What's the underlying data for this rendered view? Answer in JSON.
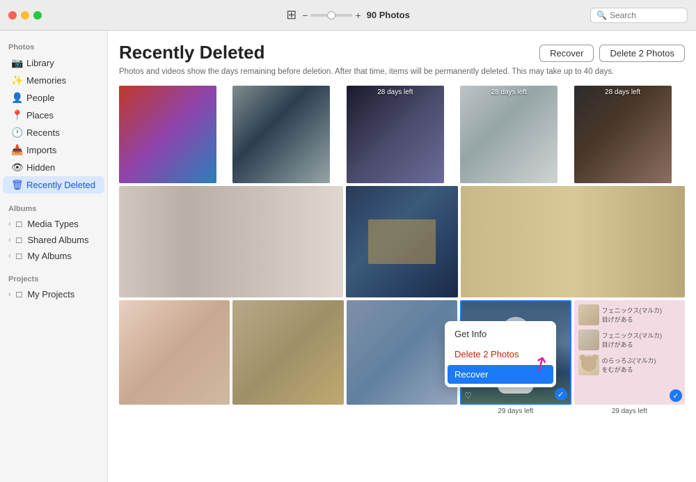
{
  "titleBar": {
    "title": "90 Photos",
    "search": {
      "placeholder": "Search"
    },
    "zoom": {
      "minus": "−",
      "plus": "+"
    }
  },
  "sidebar": {
    "photosLabel": "Photos",
    "albumsLabel": "Albums",
    "projectsLabel": "Projects",
    "items": [
      {
        "id": "library",
        "label": "Library",
        "icon": "📷"
      },
      {
        "id": "memories",
        "label": "Memories",
        "icon": "✨"
      },
      {
        "id": "people",
        "label": "People",
        "icon": "👤"
      },
      {
        "id": "places",
        "label": "Places",
        "icon": "📍"
      },
      {
        "id": "recents",
        "label": "Recents",
        "icon": "🕐"
      },
      {
        "id": "imports",
        "label": "Imports",
        "icon": "📥"
      },
      {
        "id": "hidden",
        "label": "Hidden",
        "icon": "👁"
      },
      {
        "id": "recently-deleted",
        "label": "Recently Deleted",
        "icon": "🗑",
        "active": true
      }
    ],
    "albumGroups": [
      {
        "id": "media-types",
        "label": "Media Types"
      },
      {
        "id": "shared-albums",
        "label": "Shared Albums"
      },
      {
        "id": "my-albums",
        "label": "My Albums"
      }
    ],
    "projectGroups": [
      {
        "id": "my-projects",
        "label": "My Projects"
      }
    ]
  },
  "content": {
    "pageTitle": "Recently Deleted",
    "subtitle": "Photos and videos show the days remaining before deletion. After that time, items will be permanently deleted. This may take up to 40 days.",
    "recoverBtn": "Recover",
    "deleteBtn": "Delete 2 Photos",
    "photoCount": "90 Photos",
    "daysLabels": {
      "28": "28 days left",
      "29": "29 days left"
    },
    "contextMenu": {
      "getInfo": "Get Info",
      "delete": "Delete 2 Photos",
      "recover": "Recover"
    }
  }
}
